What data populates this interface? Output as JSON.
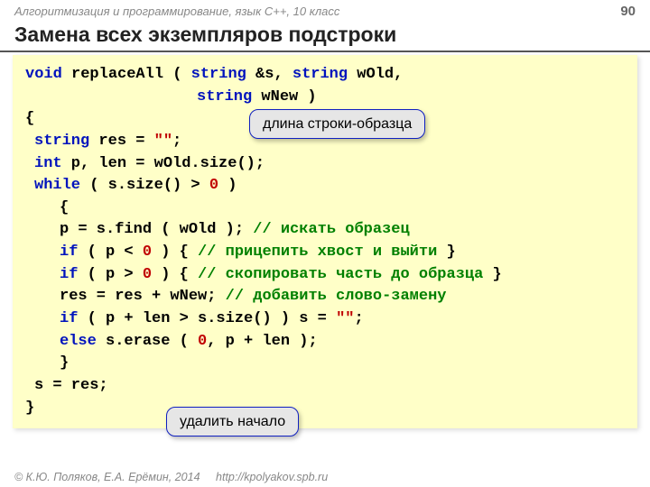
{
  "header": {
    "course": "Алгоритмизация и программирование, язык C++, 10 класс",
    "page": "90"
  },
  "title": "Замена всех экземпляров подстроки",
  "code": {
    "l1a": "void",
    "l1b": " replaceAll ( ",
    "l1c": "string",
    "l1d": " &s, ",
    "l1e": "string",
    "l1f": " wOld,",
    "l2a": "string",
    "l2b": " wNew )",
    "l3": "{",
    "l4a": "string",
    "l4b": " res = ",
    "l4c": "\"\"",
    "l4d": ";",
    "l5a": "int",
    "l5b": " p, len = wOld.size();",
    "l6a": "while",
    "l6b": " ( s.size() > ",
    "l6c": "0",
    "l6d": " )",
    "l7": "{",
    "l8a": "p = s.find ( wOld ); ",
    "l8b": "// искать образец",
    "l9a": "if",
    "l9b": " ( p < ",
    "l9c": "0",
    "l9d": " ) { ",
    "l9e": "// прицепить хвост и выйти",
    "l9f": " }",
    "l10a": "if",
    "l10b": " ( p > ",
    "l10c": "0",
    "l10d": " ) { ",
    "l10e": "// скопировать часть до образца",
    "l10f": " }",
    "l11a": "res = res + wNew; ",
    "l11b": "// добавить слово-замену",
    "l12a": "if",
    "l12b": " ( p + len > s.size() ) s = ",
    "l12c": "\"\"",
    "l12d": ";",
    "l13a": "else",
    "l13b": " s.erase ( ",
    "l13c": "0",
    "l13d": ", p + len );",
    "l14": "}",
    "l15": "s = res;",
    "l16": "}"
  },
  "callouts": {
    "c1": "длина строки-образца",
    "c2": "удалить начало"
  },
  "footer": {
    "copyright": "© К.Ю. Поляков, Е.А. Ерёмин, 2014",
    "link": "http://kpolyakov.spb.ru"
  }
}
